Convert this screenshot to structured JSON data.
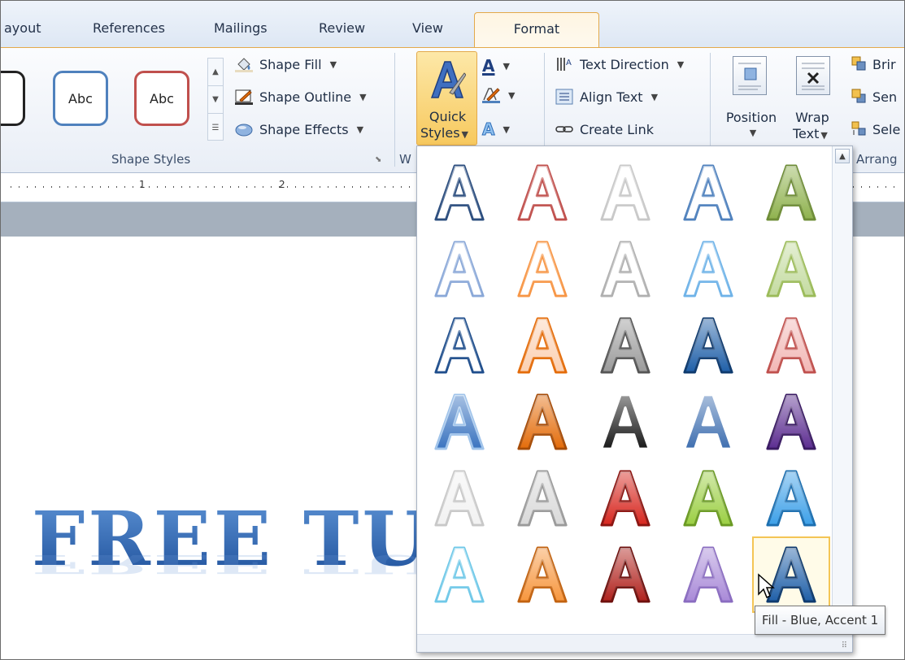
{
  "tabs": [
    {
      "label": "ayout"
    },
    {
      "label": "References"
    },
    {
      "label": "Mailings"
    },
    {
      "label": "Review"
    },
    {
      "label": "View"
    },
    {
      "label": "Format"
    }
  ],
  "ribbon": {
    "shape_styles": {
      "label": "Shape Styles",
      "previews": [
        "Abc",
        "Abc"
      ],
      "shape_fill": "Shape Fill",
      "shape_outline": "Shape Outline",
      "shape_effects": "Shape Effects"
    },
    "wordart_label_fragment": "W",
    "quick_styles": {
      "line1": "Quick",
      "line2": "Styles"
    },
    "text": {
      "text_direction": "Text Direction",
      "align_text": "Align Text",
      "create_link": "Create Link"
    },
    "arrange": {
      "position": "Position",
      "wrap_line1": "Wrap",
      "wrap_line2": "Text",
      "bring": "Brir",
      "send": "Sen",
      "select": "Sele",
      "label": "Arrang"
    }
  },
  "ruler": {
    "marks": [
      "1",
      "2"
    ]
  },
  "document": {
    "wordart_text": "FREE TU"
  },
  "gallery": {
    "styles": [
      {
        "fill": "#ffffff",
        "stroke": "#2b4d7e",
        "style": "outline-dark"
      },
      {
        "fill": "#ffffff",
        "stroke": "#c0504d",
        "style": "outline-red"
      },
      {
        "fill": "#ffffff",
        "stroke": "#c8c8c8",
        "style": "outline-light"
      },
      {
        "fill": "#ffffff",
        "stroke": "#4f81bd",
        "style": "outline-blue"
      },
      {
        "fill": "#8fb24e",
        "stroke": "#6d8c35",
        "style": "fill-green"
      },
      {
        "fill": "#ffffff",
        "stroke": "#8aa8d8",
        "style": "glow-blue"
      },
      {
        "fill": "#ffffff",
        "stroke": "#f79646",
        "style": "glow-orange"
      },
      {
        "fill": "#ffffff",
        "stroke": "#b0b0b0",
        "style": "glow-grey"
      },
      {
        "fill": "#ffffff",
        "stroke": "#6fb3e8",
        "style": "glow-sky"
      },
      {
        "fill": "#c4dba0",
        "stroke": "#9bbb59",
        "style": "glow-green"
      },
      {
        "fill": "#ffffff",
        "stroke": "#1f4e8c",
        "style": "bevel-navy"
      },
      {
        "fill": "#fbd0b2",
        "stroke": "#e46c0a",
        "style": "bevel-orange"
      },
      {
        "fill": "#9a9a9a",
        "stroke": "#555555",
        "style": "bevel-grey"
      },
      {
        "fill": "#1f5fa8",
        "stroke": "#0e3a6e",
        "style": "solid-blue"
      },
      {
        "fill": "#f2b7b5",
        "stroke": "#c0504d",
        "style": "soft-red"
      },
      {
        "fill": "#3b74c0",
        "stroke": "#9fc3ea",
        "style": "glow-fill-blue"
      },
      {
        "fill": "#e46c0a",
        "stroke": "#a64b06",
        "style": "solid-orange"
      },
      {
        "fill": "#1a1a1a",
        "stroke": "#ffffff",
        "style": "solid-black"
      },
      {
        "fill": "#3f6fb0",
        "stroke": "#ffffff",
        "style": "solid-steel"
      },
      {
        "fill": "#5c2d91",
        "stroke": "#3a1a63",
        "style": "solid-purple"
      },
      {
        "fill": "#f2f2f2",
        "stroke": "#c8c8c8",
        "style": "faint-grey"
      },
      {
        "fill": "#d9d9d9",
        "stroke": "#9a9a9a",
        "style": "metal-grey"
      },
      {
        "fill": "#d7261e",
        "stroke": "#8c1410",
        "style": "metal-red"
      },
      {
        "fill": "#9bcf43",
        "stroke": "#6a9a22",
        "style": "metal-green"
      },
      {
        "fill": "#3da0e8",
        "stroke": "#1c6fb0",
        "style": "metal-blue"
      },
      {
        "fill": "#ffffff",
        "stroke": "#6fc8e8",
        "style": "outline-aqua"
      },
      {
        "fill": "#f7963d",
        "stroke": "#c2620f",
        "style": "grad-orange"
      },
      {
        "fill": "#b0211c",
        "stroke": "#6e0f0c",
        "style": "grad-darkred"
      },
      {
        "fill": "#a98ad8",
        "stroke": "#8a6cc0",
        "style": "soft-purple"
      },
      {
        "fill": "#1f5fa8",
        "stroke": "#0e3a6e",
        "style": "fill-blue-accent1"
      }
    ],
    "selected_index": 29,
    "tooltip": "Fill - Blue, Accent 1"
  }
}
